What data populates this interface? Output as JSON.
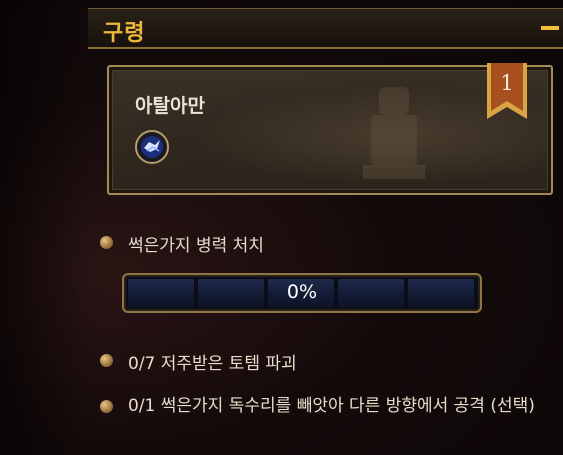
{
  "header": {
    "title": "구령"
  },
  "card": {
    "name": "아탈아만",
    "rank": "1"
  },
  "objectives": [
    {
      "text": "썩은가지 병력 처치"
    },
    {
      "text": "0/7 저주받은 토템 파괴"
    },
    {
      "text": "0/1 썩은가지 독수리를 빼앗아 다른 방향에서 공격 (선택)"
    }
  ],
  "progress": {
    "label": "0%",
    "fraction": 0,
    "segments": 5
  },
  "icons": {
    "collapse": "minus-icon",
    "rune": "blue-rune-icon",
    "ribbon": "rank-ribbon-icon",
    "bullet": "bullet-icon"
  },
  "colors": {
    "accent": "#f0b83a",
    "card_border": "#a58a56",
    "text": "#e6ddcc"
  }
}
